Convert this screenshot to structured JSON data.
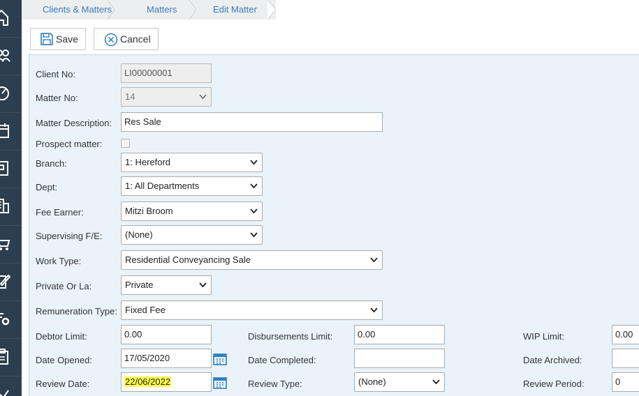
{
  "breadcrumb": [
    "Clients & Matters",
    "Matters",
    "Edit Matter"
  ],
  "toolbar": {
    "save_label": "Save",
    "cancel_label": "Cancel"
  },
  "form": {
    "client_no": {
      "label": "Client No:",
      "value": "LI00000001"
    },
    "matter_no": {
      "label": "Matter No:",
      "value": "14"
    },
    "matter_description": {
      "label": "Matter Description:",
      "value": "Res Sale"
    },
    "prospect_matter": {
      "label": "Prospect matter:",
      "checked": false
    },
    "branch": {
      "label": "Branch:",
      "value": "1: Hereford"
    },
    "dept": {
      "label": "Dept:",
      "value": "1: All Departments"
    },
    "fee_earner": {
      "label": "Fee Earner:",
      "value": "Mitzi Broom"
    },
    "supervising_fe": {
      "label": "Supervising F/E:",
      "value": "(None)"
    },
    "work_type": {
      "label": "Work Type:",
      "value": "Residential Conveyancing Sale"
    },
    "private_or_la": {
      "label": "Private Or La:",
      "value": "Private"
    },
    "remuneration_type": {
      "label": "Remuneration Type:",
      "value": "Fixed Fee"
    },
    "debtor_limit": {
      "label": "Debtor Limit:",
      "value": "0.00"
    },
    "disbursements_limit": {
      "label": "Disbursements Limit:",
      "value": "0.00"
    },
    "wip_limit": {
      "label": "WIP Limit:",
      "value": "0.00"
    },
    "date_opened": {
      "label": "Date Opened:",
      "value": "17/05/2020"
    },
    "date_completed": {
      "label": "Date Completed:",
      "value": ""
    },
    "date_archived": {
      "label": "Date Archived:",
      "value": ""
    },
    "review_date": {
      "label": "Review Date:",
      "value": "22/06/2022"
    },
    "review_type": {
      "label": "Review Type:",
      "value": "(None)"
    },
    "review_period": {
      "label": "Review Period:",
      "value": "0"
    }
  },
  "nav_icons": [
    "home-icon",
    "people-icon",
    "gauge-icon",
    "calendar-icon",
    "document-icon",
    "building-icon",
    "cart-icon",
    "edit-icon",
    "settings-list-icon",
    "clipboard-icon",
    "chart-icon"
  ],
  "colors": {
    "nav_bg": "#2d3e50",
    "panel_bg": "#eaf3fa",
    "link": "#3a7bbf",
    "highlight": "#ffff4c",
    "calendar": "#2f7fc1"
  }
}
